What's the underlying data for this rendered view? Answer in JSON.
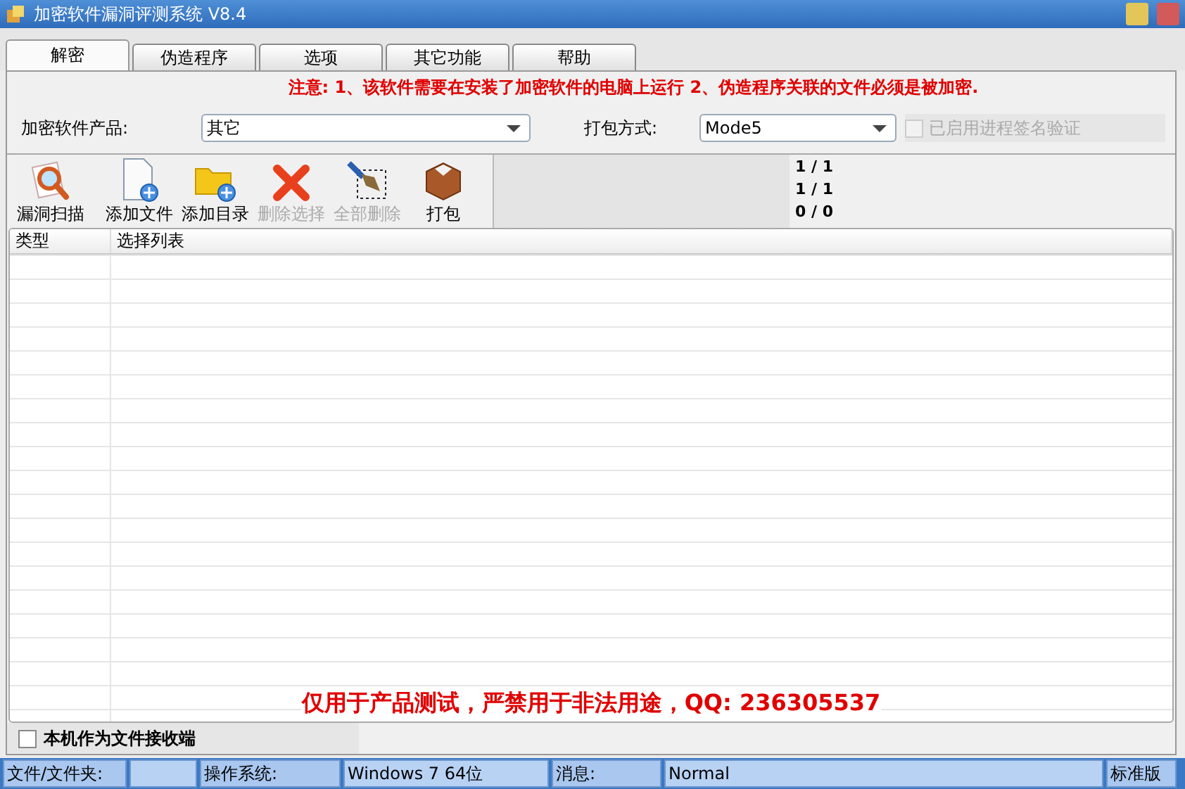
{
  "window": {
    "title": "加密软件漏洞评测系统  V8.4"
  },
  "tabs": [
    {
      "label": "解密",
      "selected": true
    },
    {
      "label": "伪造程序",
      "selected": false
    },
    {
      "label": "选项",
      "selected": false
    },
    {
      "label": "其它功能",
      "selected": false
    },
    {
      "label": "帮助",
      "selected": false
    }
  ],
  "notice": "注意: 1、该软件需要在安装了加密软件的电脑上运行  2、伪造程序关联的文件必须是被加密.",
  "product": {
    "label": "加密软件产品:",
    "value": "其它"
  },
  "pack_mode": {
    "label": "打包方式:",
    "value": "Mode5"
  },
  "signature_check": {
    "label": "已启用进程签名验证",
    "checked": false,
    "disabled": true
  },
  "toolbar": [
    {
      "kind": "scan",
      "label": "漏洞扫描",
      "disabled": false
    },
    {
      "kind": "add-file",
      "label": "添加文件",
      "disabled": false
    },
    {
      "kind": "add-folder",
      "label": "添加目录",
      "disabled": false
    },
    {
      "kind": "delete",
      "label": "删除选择",
      "disabled": true
    },
    {
      "kind": "clear",
      "label": "全部删除",
      "disabled": true
    },
    {
      "kind": "pack",
      "label": "打包",
      "disabled": false
    }
  ],
  "counters": [
    "1 / 1",
    "1 / 1",
    "0 / 0"
  ],
  "table": {
    "columns": [
      "类型",
      "选择列表"
    ]
  },
  "disclaimer": "仅用于产品测试，严禁用于非法用途，QQ: 236305537",
  "receiver": {
    "label": "本机作为文件接收端",
    "checked": false
  },
  "status_bar": [
    {
      "kind": "label",
      "text": "文件/文件夹:"
    },
    {
      "kind": "value"
    },
    {
      "kind": "label",
      "text": "操作系统:"
    },
    {
      "kind": "value",
      "text": "Windows 7 64位"
    },
    {
      "kind": "label",
      "text": "消息:"
    },
    {
      "kind": "value",
      "text": "Normal"
    },
    {
      "kind": "label",
      "text": "标准版"
    }
  ]
}
